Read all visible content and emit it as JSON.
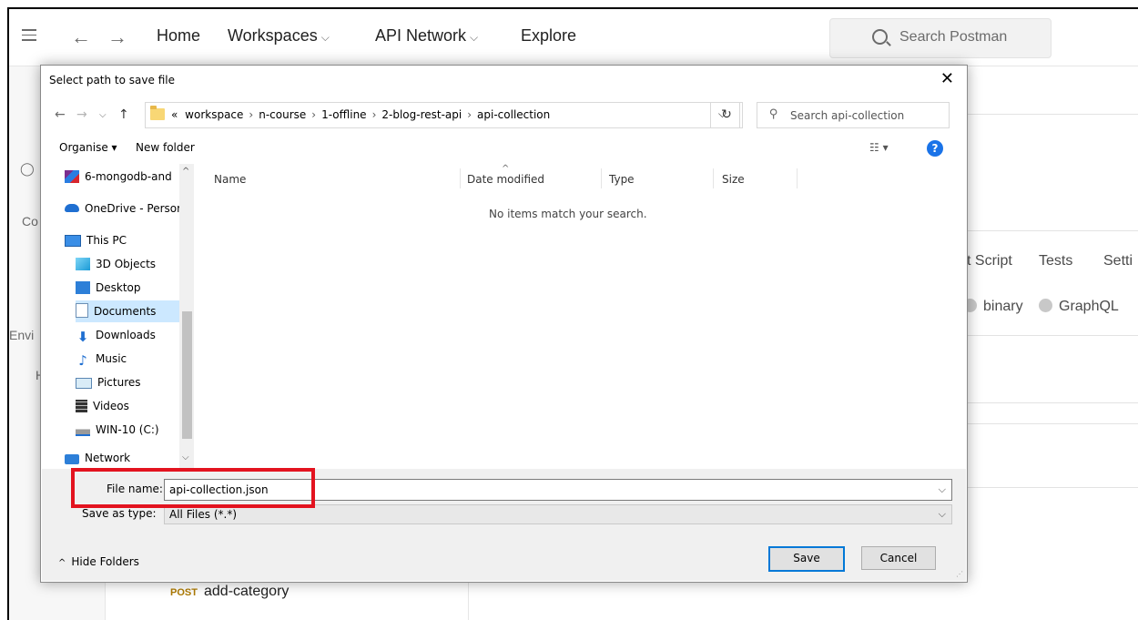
{
  "postman": {
    "nav": {
      "home": "Home",
      "workspaces": "Workspaces",
      "api_network": "API Network",
      "explore": "Explore",
      "chevron": "⌵"
    },
    "search_placeholder": "Search Postman",
    "side_partial": {
      "collections": "Co",
      "environments": "Envi",
      "history": "H"
    },
    "tabs_partial": {
      "script": "t Script",
      "tests": "Tests",
      "settings": "Setti"
    },
    "body_types": {
      "binary": "binary",
      "graphql": "GraphQL"
    },
    "request": {
      "method": "POST",
      "name": "add-category"
    }
  },
  "dialog": {
    "title": "Select path to save file",
    "breadcrumb": [
      "«",
      "workspace",
      "n-course",
      "1-offline",
      "2-blog-rest-api",
      "api-collection"
    ],
    "search_placeholder": "Search api-collection",
    "organise": "Organise ▾",
    "new_folder": "New folder",
    "nav_items": [
      {
        "label": "6-mongodb-and",
        "icon": "winrar-icon"
      },
      {
        "label": "OneDrive - Persor",
        "icon": "onedrive-icon"
      },
      {
        "label": "This PC",
        "icon": "computer-icon"
      },
      {
        "label": "3D Objects",
        "icon": "3d-objects-icon"
      },
      {
        "label": "Desktop",
        "icon": "desktop-icon"
      },
      {
        "label": "Documents",
        "icon": "documents-icon"
      },
      {
        "label": "Downloads",
        "icon": "downloads-icon"
      },
      {
        "label": "Music",
        "icon": "music-icon"
      },
      {
        "label": "Pictures",
        "icon": "pictures-icon"
      },
      {
        "label": "Videos",
        "icon": "videos-icon"
      },
      {
        "label": "WIN-10 (C:)",
        "icon": "drive-icon"
      },
      {
        "label": "Network",
        "icon": "network-icon"
      }
    ],
    "columns": {
      "name": "Name",
      "date_modified": "Date modified",
      "type": "Type",
      "size": "Size"
    },
    "empty_message": "No items match your search.",
    "file_name_label": "File name:",
    "file_name_value": "api-collection.json",
    "save_as_type_label": "Save as type:",
    "save_as_type_value": "All Files (*.*)",
    "hide_folders": "Hide Folders",
    "save": "Save",
    "cancel": "Cancel"
  },
  "colors": {
    "highlight": "#e3131f",
    "help": "#1a73e8",
    "selection": "#cce8ff",
    "post_method": "#ad7a03"
  }
}
